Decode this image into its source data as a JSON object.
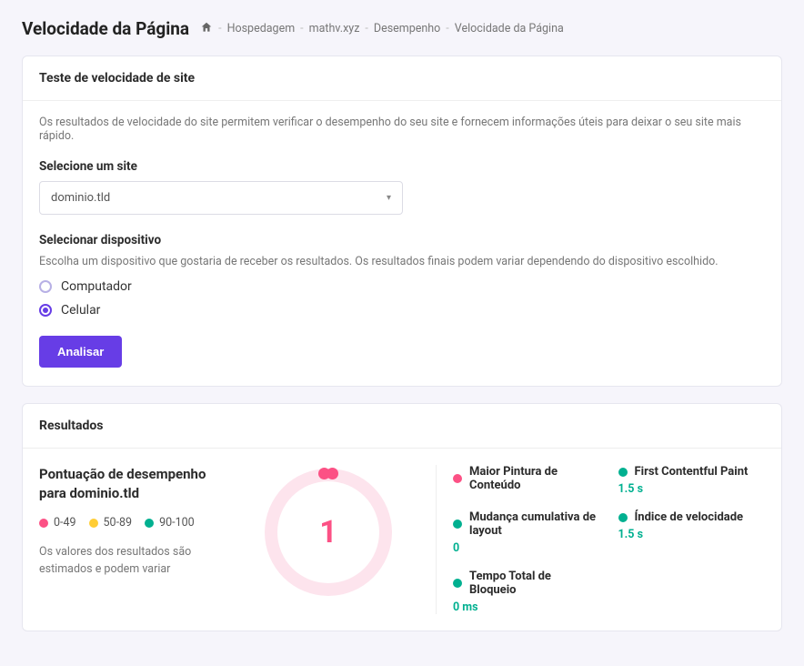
{
  "page_title": "Velocidade da Página",
  "breadcrumb": [
    "Hospedagem",
    "mathv.xyz",
    "Desempenho",
    "Velocidade da Página"
  ],
  "test_card": {
    "title": "Teste de velocidade de site",
    "intro": "Os resultados de velocidade do site permitem verificar o desempenho do seu site e fornecem informações úteis para deixar o seu site mais rápido.",
    "site_label": "Selecione um site",
    "site_value": "dominio.tld",
    "device_label": "Selecionar dispositivo",
    "device_hint": "Escolha um dispositivo que gostaria de receber os resultados. Os resultados finais podem variar dependendo do dispositivo escolhido.",
    "devices": [
      {
        "label": "Computador",
        "selected": false
      },
      {
        "label": "Celular",
        "selected": true
      }
    ],
    "analyze_label": "Analisar"
  },
  "colors": {
    "red": "#fc5185",
    "amber": "#ffcd35",
    "green": "#00b090"
  },
  "results": {
    "title": "Resultados",
    "score_for_prefix": "Pontuação de desempenho para ",
    "domain": "dominio.tld",
    "legend": [
      "0-49",
      "50-89",
      "90-100"
    ],
    "score": "1",
    "footnote": "Os valores dos resultados são estimados e podem variar",
    "metrics": [
      {
        "name": "Maior Pintura de Conteúdo",
        "value": "",
        "color_key": "red",
        "value_color": "#2c2c2c"
      },
      {
        "name": "First Contentful Paint",
        "value": "1.5 s",
        "color_key": "green",
        "value_color": "#00b090"
      },
      {
        "name": "Mudança cumulativa de layout",
        "value": "0",
        "color_key": "green",
        "value_color": "#00b090"
      },
      {
        "name": "Índice de velocidade",
        "value": "1.5 s",
        "color_key": "green",
        "value_color": "#00b090"
      },
      {
        "name": "Tempo Total de Bloqueio",
        "value": "0 ms",
        "color_key": "green",
        "value_color": "#00b090"
      }
    ]
  }
}
